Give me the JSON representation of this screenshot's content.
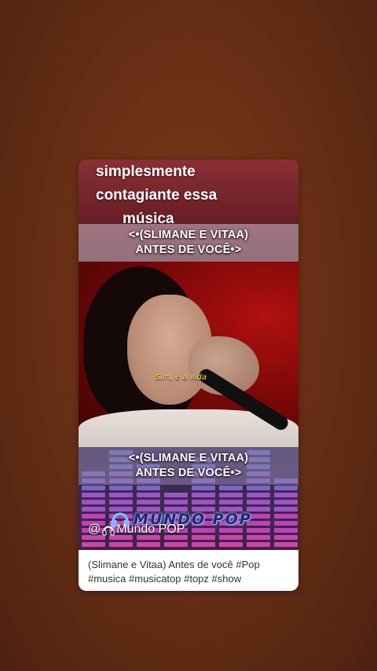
{
  "overlay": {
    "line1": "simplesmente",
    "line2": "contagiante essa",
    "line3": "música"
  },
  "title_top": {
    "line1": "<•(SLIMANE E VITAA)",
    "line2": "ANTES DE VOCÊ•>"
  },
  "video": {
    "subtitle": "Sim, é a vida"
  },
  "title_bottom": {
    "line1": "<•(SLIMANE E VITAA)",
    "line2": "ANTES DE VOCÊ•>"
  },
  "logo": {
    "text": "MUNDO POP",
    "icon": "headphones-icon"
  },
  "channel": {
    "prefix": "@",
    "name": "Mundo POP",
    "icon": "headphones-icon"
  },
  "caption": {
    "text": "(Slimane e Vitaa) Antes de você #Pop #musica #musicatop #topz #show"
  },
  "colors": {
    "background": "#6a3016",
    "card": "#ffffff",
    "subtitle": "#f6e94a",
    "logo_glow": "#5fd6ff"
  }
}
